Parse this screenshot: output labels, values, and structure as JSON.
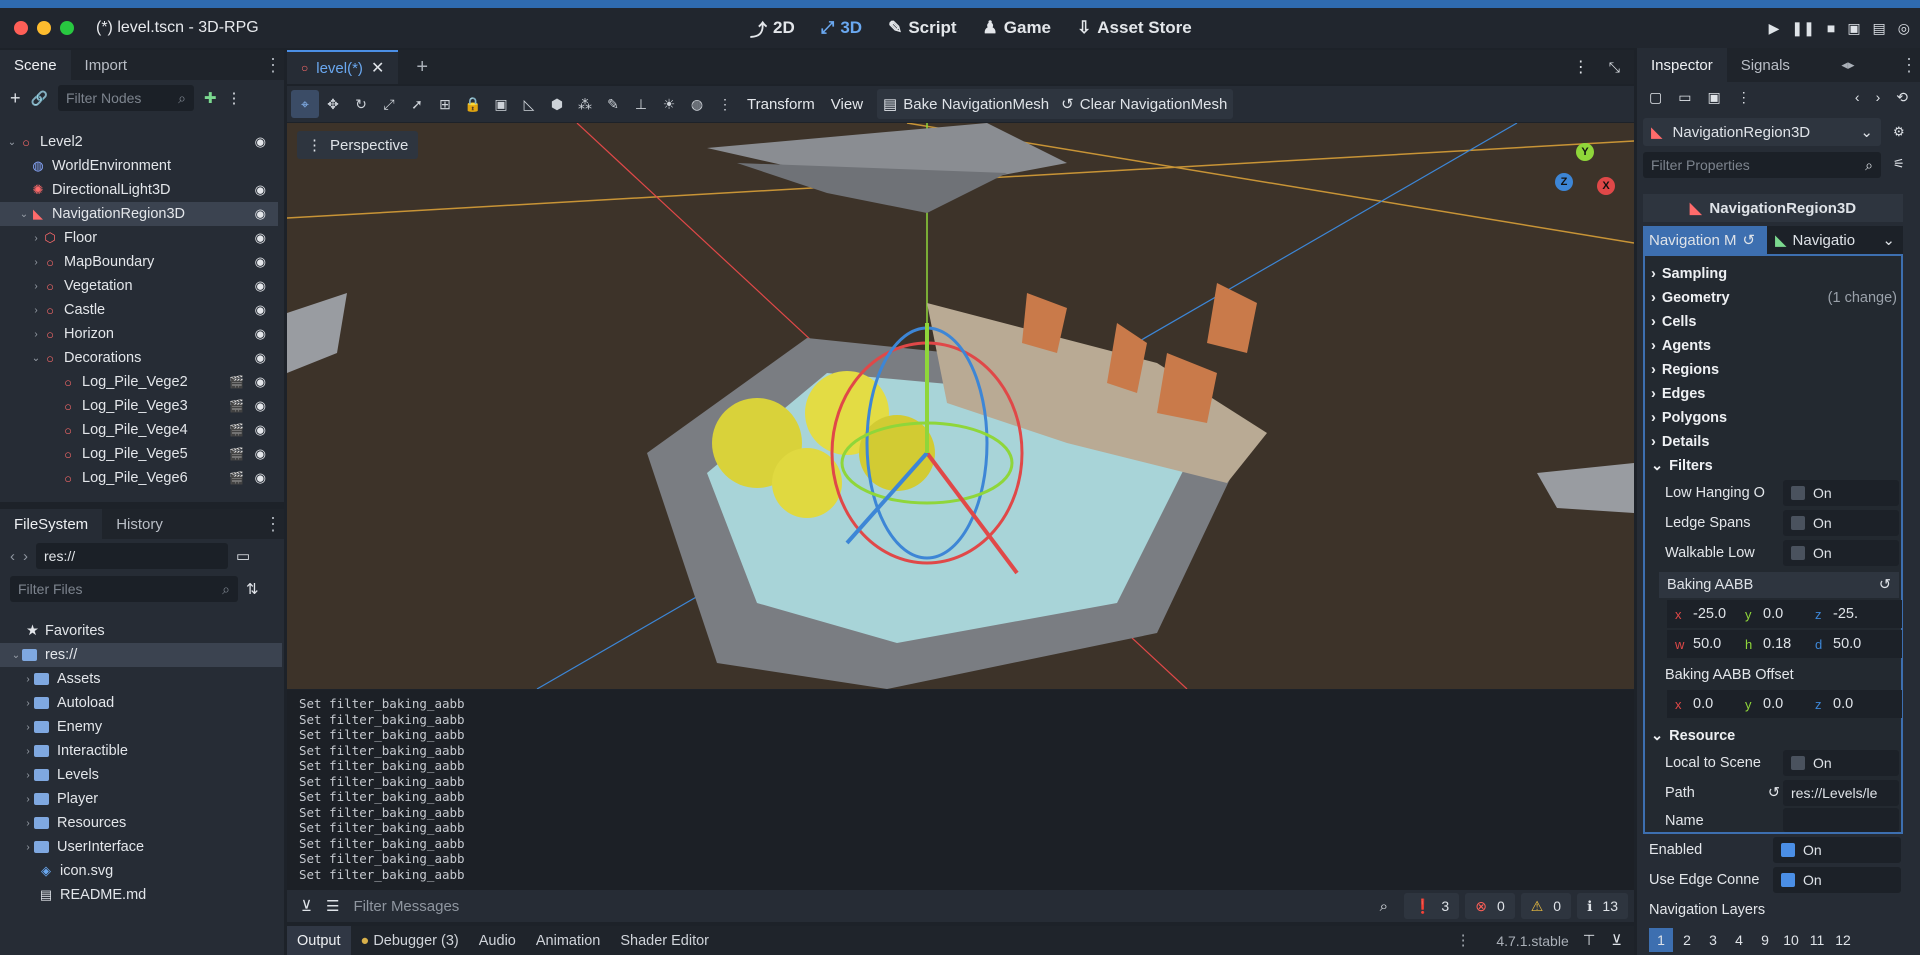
{
  "window": {
    "title": "(*) level.tscn - 3D-RPG"
  },
  "modes": [
    {
      "label": "2D",
      "icon": "2d-icon"
    },
    {
      "label": "3D",
      "icon": "3d-icon"
    },
    {
      "label": "Script",
      "icon": "script-icon"
    },
    {
      "label": "Game",
      "icon": "game-icon"
    },
    {
      "label": "Asset Store",
      "icon": "asset-store-icon"
    }
  ],
  "scene_dock": {
    "tabs": [
      "Scene",
      "Import"
    ],
    "filter_placeholder": "Filter Nodes",
    "nodes": [
      {
        "label": "Level2",
        "icon_color": "#ff6b6b",
        "level": 0
      },
      {
        "label": "WorldEnvironment",
        "icon_color": "#ff6b6b",
        "level": 1
      },
      {
        "label": "DirectionalLight3D",
        "icon_color": "#ff6b6b",
        "level": 1
      },
      {
        "label": "NavigationRegion3D",
        "icon_color": "#ff6b6b",
        "level": 1
      },
      {
        "label": "Floor",
        "icon_color": "#ff6b6b",
        "level": 2
      },
      {
        "label": "MapBoundary",
        "icon_color": "#ff6b6b",
        "level": 2
      },
      {
        "label": "Vegetation",
        "icon_color": "#ff6b6b",
        "level": 2
      },
      {
        "label": "Castle",
        "icon_color": "#ff6b6b",
        "level": 2
      },
      {
        "label": "Horizon",
        "icon_color": "#ff6b6b",
        "level": 2
      },
      {
        "label": "Decorations",
        "icon_color": "#ff6b6b",
        "level": 2
      },
      {
        "label": "Log_Pile_Vege2",
        "icon_color": "#ff6b6b",
        "level": 3
      },
      {
        "label": "Log_Pile_Vege3",
        "icon_color": "#ff6b6b",
        "level": 3
      },
      {
        "label": "Log_Pile_Vege4",
        "icon_color": "#ff6b6b",
        "level": 3
      },
      {
        "label": "Log_Pile_Vege5",
        "icon_color": "#ff6b6b",
        "level": 3
      },
      {
        "label": "Log_Pile_Vege6",
        "icon_color": "#ff6b6b",
        "level": 3
      }
    ]
  },
  "filesystem_dock": {
    "tabs": [
      "FileSystem",
      "History"
    ],
    "path": "res://",
    "filter_placeholder": "Filter Files",
    "favorites_label": "Favorites",
    "root_label": "res://",
    "folders": [
      "Assets",
      "Autoload",
      "Enemy",
      "Interactible",
      "Levels",
      "Player",
      "Resources",
      "UserInterface"
    ],
    "files": [
      "icon.svg",
      "README.md"
    ]
  },
  "editor": {
    "scene_tab": "level(*)",
    "toolbar": {
      "transform_label": "Transform",
      "view_label": "View",
      "bake_label": "Bake NavigationMesh",
      "clear_label": "Clear NavigationMesh"
    },
    "perspective_label": "Perspective",
    "gizmo": {
      "x": "X",
      "y": "Y",
      "z": "Z"
    }
  },
  "output": {
    "lines": [
      "Set filter_baking_aabb",
      "Set filter_baking_aabb",
      "Set filter_baking_aabb",
      "Set filter_baking_aabb",
      "Set filter_baking_aabb",
      "Set filter_baking_aabb",
      "Set filter_baking_aabb",
      "Set filter_baking_aabb",
      "Set filter_baking_aabb",
      "Set filter_baking_aabb",
      "Set filter_baking_aabb",
      "Set filter_baking_aabb"
    ],
    "filter_placeholder": "Filter Messages",
    "counts": {
      "messages": "3",
      "errors": "0",
      "warnings": "0",
      "info": "13"
    }
  },
  "bottom_tabs": [
    "Output",
    "Debugger (3)",
    "Audio",
    "Animation",
    "Shader Editor"
  ],
  "version": "4.7.1.stable",
  "inspector": {
    "tabs": [
      "Inspector",
      "Signals"
    ],
    "node_selector": "NavigationRegion3D",
    "filter_placeholder": "Filter Properties",
    "object_title": "NavigationRegion3D",
    "resource_prop": "Navigation M",
    "resource_value": "Navigatio",
    "sections": [
      "Sampling",
      "Geometry",
      "Cells",
      "Agents",
      "Regions",
      "Edges",
      "Polygons",
      "Details",
      "Filters"
    ],
    "geometry_note": "(1 change)",
    "filters": {
      "low_hanging": {
        "label": "Low Hanging O",
        "value": "On"
      },
      "ledge_spans": {
        "label": "Ledge Spans",
        "value": "On"
      },
      "walkable_low": {
        "label": "Walkable Low",
        "value": "On"
      },
      "baking_aabb_label": "Baking AABB",
      "aabb": {
        "x": "-25.0",
        "y": "0.0",
        "z": "-25.",
        "w": "50.0",
        "h": "0.18",
        "d": "50.0"
      },
      "offset_label": "Baking AABB Offset",
      "offset": {
        "x": "0.0",
        "y": "0.0",
        "z": "0.0"
      }
    },
    "resource_section": "Resource",
    "local_to_scene": {
      "label": "Local to Scene",
      "value": "On"
    },
    "path": {
      "label": "Path",
      "value": "res://Levels/le"
    },
    "name_label": "Name",
    "enabled": {
      "label": "Enabled",
      "value": "On"
    },
    "edge_conn": {
      "label": "Use Edge Conne",
      "value": "On"
    },
    "nav_layers_label": "Navigation Layers",
    "layers": [
      "1",
      "2",
      "3",
      "4",
      "9",
      "10",
      "11",
      "12"
    ]
  }
}
